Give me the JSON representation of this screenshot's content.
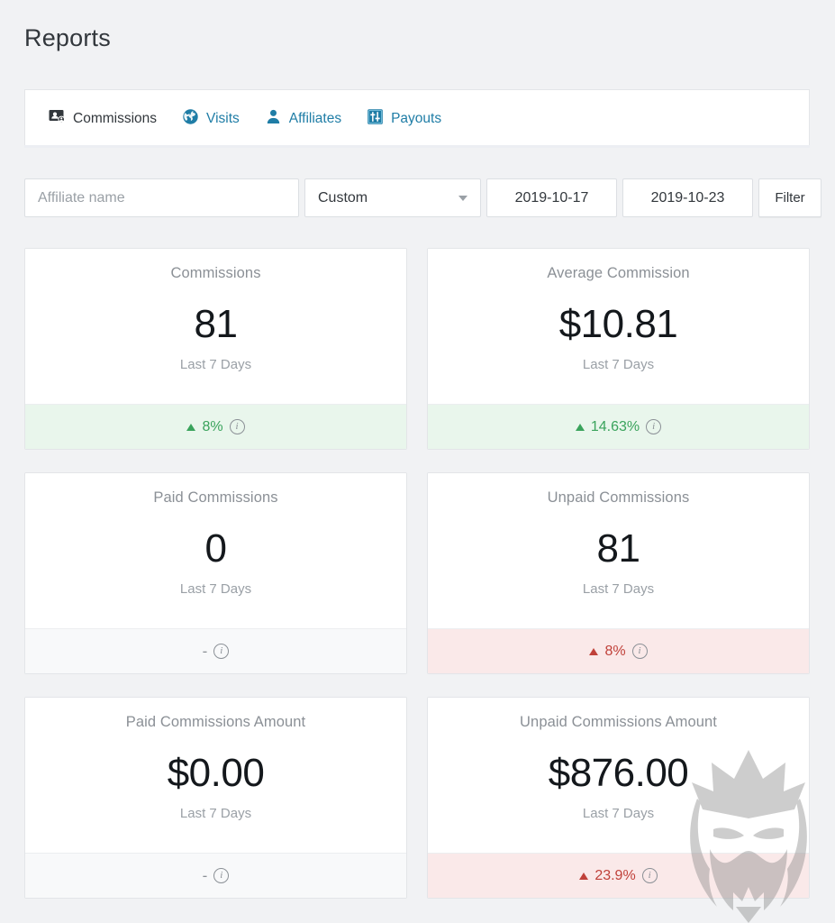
{
  "page": {
    "title": "Reports",
    "background_color": "#f1f2f4"
  },
  "tabs": [
    {
      "label": "Commissions",
      "icon": "commissions-card-icon",
      "active": true
    },
    {
      "label": "Visits",
      "icon": "globe-icon",
      "active": false
    },
    {
      "label": "Affiliates",
      "icon": "person-icon",
      "active": false
    },
    {
      "label": "Payouts",
      "icon": "sliders-icon",
      "active": false
    }
  ],
  "filters": {
    "affiliate_name": {
      "value": "",
      "placeholder": "Affiliate name"
    },
    "range_select": {
      "value": "Custom"
    },
    "date_from": {
      "value": "2019-10-17"
    },
    "date_to": {
      "value": "2019-10-23"
    },
    "filter_button": {
      "label": "Filter"
    }
  },
  "cards": [
    {
      "title": "Commissions",
      "value": "81",
      "subtitle": "Last 7 Days",
      "delta": "8%",
      "direction": "up",
      "tone": "up-good",
      "has_arrow": true
    },
    {
      "title": "Average Commission",
      "value": "$10.81",
      "subtitle": "Last 7 Days",
      "delta": "14.63%",
      "direction": "up",
      "tone": "up-good",
      "has_arrow": true
    },
    {
      "title": "Paid Commissions",
      "value": "0",
      "subtitle": "Last 7 Days",
      "delta": "-",
      "direction": "none",
      "tone": "neutral",
      "has_arrow": false
    },
    {
      "title": "Unpaid Commissions",
      "value": "81",
      "subtitle": "Last 7 Days",
      "delta": "8%",
      "direction": "up",
      "tone": "up-bad",
      "has_arrow": true
    },
    {
      "title": "Paid Commissions Amount",
      "value": "$0.00",
      "subtitle": "Last 7 Days",
      "delta": "-",
      "direction": "none",
      "tone": "neutral",
      "has_arrow": false
    },
    {
      "title": "Unpaid Commissions Amount",
      "value": "$876.00",
      "subtitle": "Last 7 Days",
      "delta": "23.9%",
      "direction": "up",
      "tone": "up-bad",
      "has_arrow": true
    }
  ],
  "info_glyph": "i",
  "colors": {
    "positive": "#3aa35c",
    "positive_bg": "#e9f6ec",
    "negative": "#c0413a",
    "negative_bg": "#fae9e9",
    "neutral_bg": "#f8f9fa",
    "tab_link": "#1f7da6",
    "active_tab": "#32373c"
  },
  "watermark": {
    "name": "king-mascot-watermark"
  }
}
